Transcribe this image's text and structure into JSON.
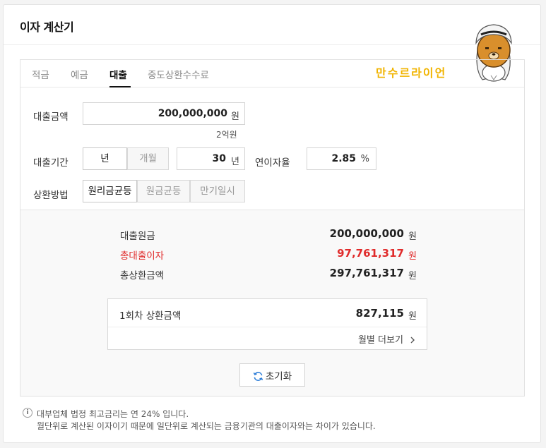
{
  "title": "이자 계산기",
  "brand_text": "만수르라이언",
  "tabs": [
    {
      "label": "적금",
      "active": false
    },
    {
      "label": "예금",
      "active": false
    },
    {
      "label": "대출",
      "active": true
    },
    {
      "label": "중도상환수수료",
      "active": false
    }
  ],
  "loan_amount": {
    "label": "대출금액",
    "value": "200,000,000",
    "unit": "원",
    "hint": "2억원"
  },
  "loan_period": {
    "label": "대출기간",
    "period_type_options": [
      "년",
      "개월"
    ],
    "selected_period_type": "년",
    "value": "30",
    "unit": "년"
  },
  "interest_rate": {
    "label": "연이자율",
    "value": "2.85",
    "unit": "%"
  },
  "repayment": {
    "label": "상환방법",
    "options": [
      "원리금균등",
      "원금균등",
      "만기일시"
    ],
    "selected": "원리금균등"
  },
  "results": {
    "principal": {
      "label": "대출원금",
      "value": "200,000,000",
      "unit": "원"
    },
    "total_interest": {
      "label": "총대출이자",
      "value": "97,761,317",
      "unit": "원"
    },
    "total_repayment": {
      "label": "총상환금액",
      "value": "297,761,317",
      "unit": "원"
    },
    "first_installment": {
      "label": "1회차 상환금액",
      "value": "827,115",
      "unit": "원"
    },
    "monthly_more": "월별 더보기"
  },
  "reset_label": "초기화",
  "notices": [
    "대부업체 법정 최고금리는 연 24% 입니다.",
    "월단위로 계산된 이자이기 때문에 일단위로 계산되는 금융기관의 대출이자와는 차이가 있습니다."
  ],
  "colors": {
    "accent_red": "#e02b2b",
    "brand_yellow": "#f1b400"
  },
  "icons": {
    "reset": "refresh-icon",
    "more": "chevron-right-icon",
    "notice": "info-icon",
    "mascot": "lion-mascot-icon"
  }
}
